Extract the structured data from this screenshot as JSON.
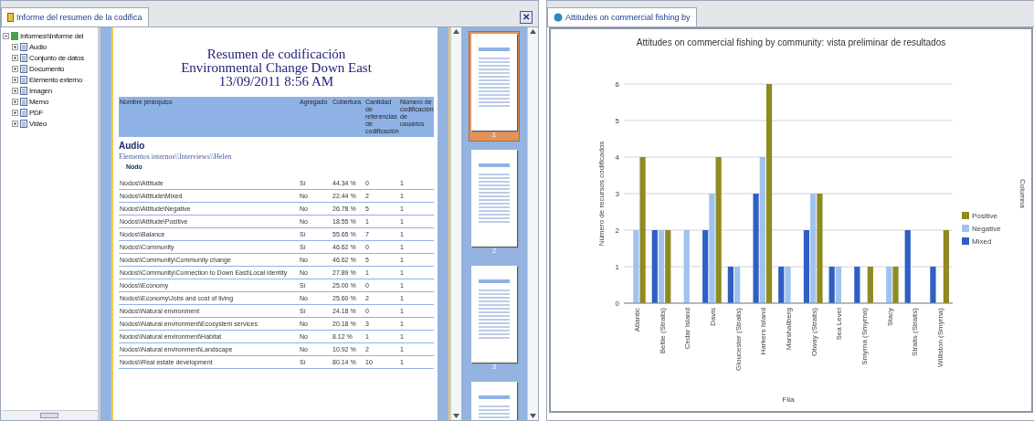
{
  "left_window": {
    "tab": {
      "label": "Informe del resumen de la codifica",
      "selected": true
    },
    "tree": {
      "root": "Informes\\\\Informe del",
      "expanded": true,
      "children": [
        {
          "label": "Audio"
        },
        {
          "label": "Conjunto de datos"
        },
        {
          "label": "Documento"
        },
        {
          "label": "Elemento externo"
        },
        {
          "label": "Imagen"
        },
        {
          "label": "Memo"
        },
        {
          "label": "PDF"
        },
        {
          "label": "Video"
        }
      ]
    },
    "report": {
      "title_lines": [
        "Resumen de codificación",
        "Environmental Change Down East",
        "13/09/2011 8:56 AM"
      ],
      "columns": [
        "Nombre jerárquico",
        "Agregado",
        "Cobertura",
        "Cantidad de referencias de codificación",
        "Número de codificación de usuarios"
      ],
      "section": "Audio",
      "source": "Elementos internos\\\\Interviews\\\\Helen",
      "group_label": "Nodo",
      "rows": [
        [
          "Nodos\\\\Attitude",
          "Sí",
          "44.34 %",
          "0",
          "1"
        ],
        [
          "Nodos\\\\Attitude\\Mixed",
          "No",
          "22.44 %",
          "2",
          "1"
        ],
        [
          "Nodos\\\\Attitude\\Negative",
          "No",
          "26.78 %",
          "5",
          "1"
        ],
        [
          "Nodos\\\\Attitude\\Positive",
          "No",
          "18.55 %",
          "1",
          "1"
        ],
        [
          "Nodos\\\\Balance",
          "Sí",
          "55.65 %",
          "7",
          "1"
        ],
        [
          "Nodos\\\\Community",
          "Sí",
          "46.62 %",
          "0",
          "1"
        ],
        [
          "Nodos\\\\Community\\Community change",
          "No",
          "46.62 %",
          "5",
          "1"
        ],
        [
          "Nodos\\\\Community\\Connection to Down East\\Local identity",
          "No",
          "27.89 %",
          "1",
          "1"
        ],
        [
          "Nodos\\\\Economy",
          "Sí",
          "25.00 %",
          "0",
          "1"
        ],
        [
          "Nodos\\\\Economy\\Jobs and cost of living",
          "No",
          "25.60 %",
          "2",
          "1"
        ],
        [
          "Nodos\\\\Natural environment",
          "Sí",
          "24.18 %",
          "0",
          "1"
        ],
        [
          "Nodos\\\\Natural environment\\Ecosystem services",
          "No",
          "20.18 %",
          "3",
          "1"
        ],
        [
          "Nodos\\\\Natural environment\\Habitat",
          "No",
          "8.12 %",
          "1",
          "1"
        ],
        [
          "Nodos\\\\Natural environment\\Landscape",
          "No",
          "10.92 %",
          "2",
          "1"
        ],
        [
          "Nodos\\\\Real estate development",
          "Sí",
          "80.14 %",
          "10",
          "1"
        ]
      ]
    },
    "thumbnails": [
      {
        "label": "1",
        "selected": true
      },
      {
        "label": "2",
        "selected": false
      },
      {
        "label": "3",
        "selected": false
      },
      {
        "selected": false
      }
    ],
    "close_label": "✕"
  },
  "right_window": {
    "tab": {
      "label": "Attitudes on commercial fishing by",
      "selected": true
    },
    "chart_data": {
      "type": "bar",
      "title": "Attitudes on commercial fishing by community: vista preliminar de resultados",
      "xlabel": "Fila",
      "ylabel": "Número de recursos codificados",
      "categories": [
        "Atlantic",
        "Beltie (Straits)",
        "Cedar Island",
        "Davis",
        "Gloucester (Straits)",
        "Harkers Island",
        "Marshallberg",
        "Otway (Straits)",
        "Sea Level",
        "Smyrna (Smyrna)",
        "Stacy",
        "Straits (Straits)",
        "Williston (Smyrna)"
      ],
      "series": [
        {
          "name": "Mixed",
          "color": "#2f5fc4",
          "values": [
            0,
            2,
            0,
            2,
            1,
            3,
            1,
            2,
            1,
            1,
            0,
            2,
            1
          ]
        },
        {
          "name": "Negative",
          "color": "#9ec3ee",
          "values": [
            2,
            2,
            2,
            3,
            1,
            4,
            1,
            3,
            1,
            0,
            1,
            0,
            0
          ]
        },
        {
          "name": "Positive",
          "color": "#8f8a22",
          "values": [
            4,
            2,
            0,
            4,
            0,
            6,
            0,
            3,
            0,
            1,
            1,
            0,
            2
          ]
        }
      ],
      "ylim": [
        0,
        6
      ],
      "yticks": [
        0,
        1,
        2,
        3,
        4,
        5,
        6
      ],
      "grid": true,
      "legend": true
    },
    "legend_title": "Columna"
  }
}
